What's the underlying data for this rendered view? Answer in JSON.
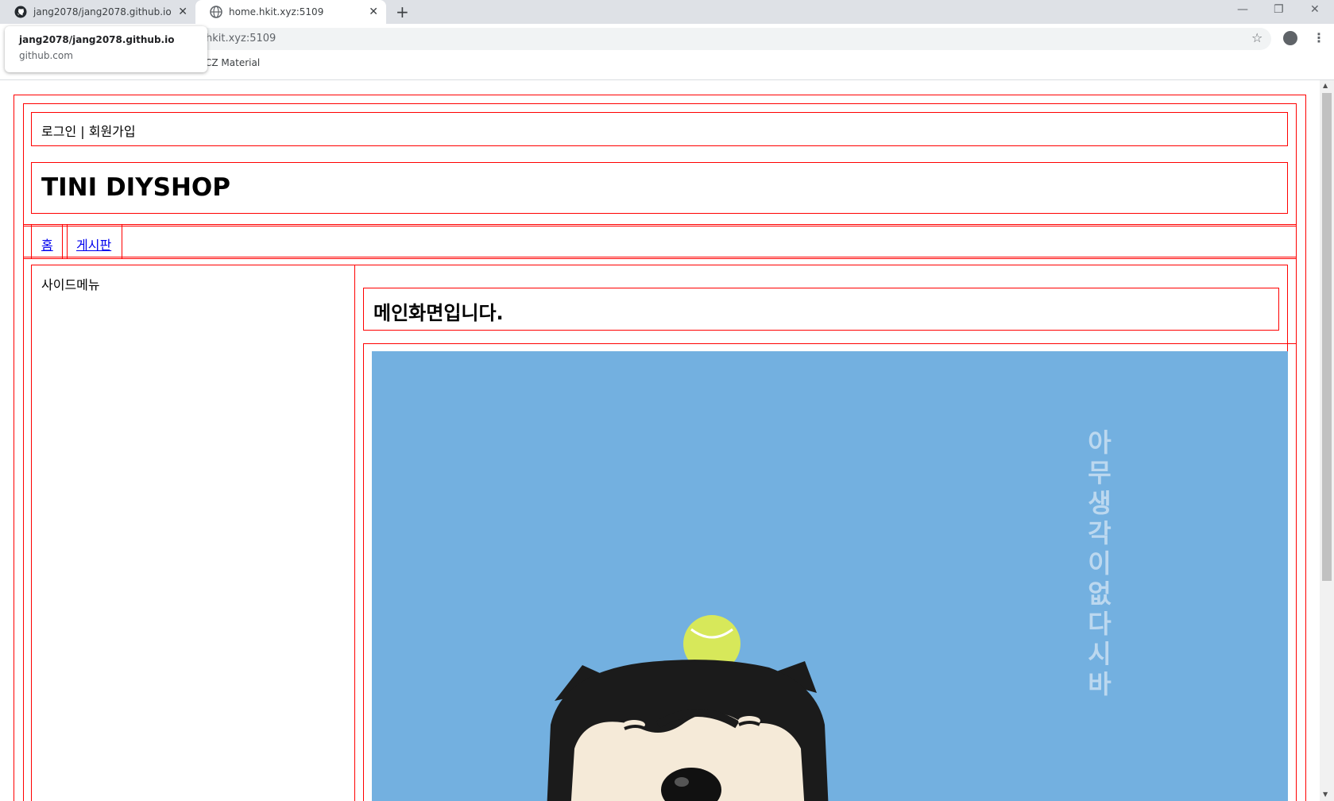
{
  "browser": {
    "tabs": [
      {
        "title": "jang2078/jang2078.github.io",
        "icon": "github-icon"
      },
      {
        "title": "home.hkit.xyz:5109",
        "icon": "globe-icon"
      }
    ],
    "tab_close_glyph": "✕",
    "new_tab_glyph": "+",
    "address": "hkit.xyz:5109",
    "bookmark": "CZ Material",
    "hovercard": {
      "title": "jang2078/jang2078.github.io",
      "domain": "github.com"
    },
    "window_controls": {
      "minimize": "—",
      "restore": "❐",
      "close": "✕"
    }
  },
  "header": {
    "auth_links": "로그인 | 회원가입",
    "site_title": "TINI DIYSHOP"
  },
  "nav": {
    "items": [
      "홈",
      "게시판"
    ]
  },
  "sidebar": {
    "title": "사이드메뉴"
  },
  "main": {
    "heading": "메인화면입니다.",
    "image": {
      "vertical_text": [
        "아",
        "무",
        "생",
        "각",
        "이",
        "없",
        "다",
        "시",
        "바"
      ],
      "bg_color": "#73b0e0"
    }
  }
}
